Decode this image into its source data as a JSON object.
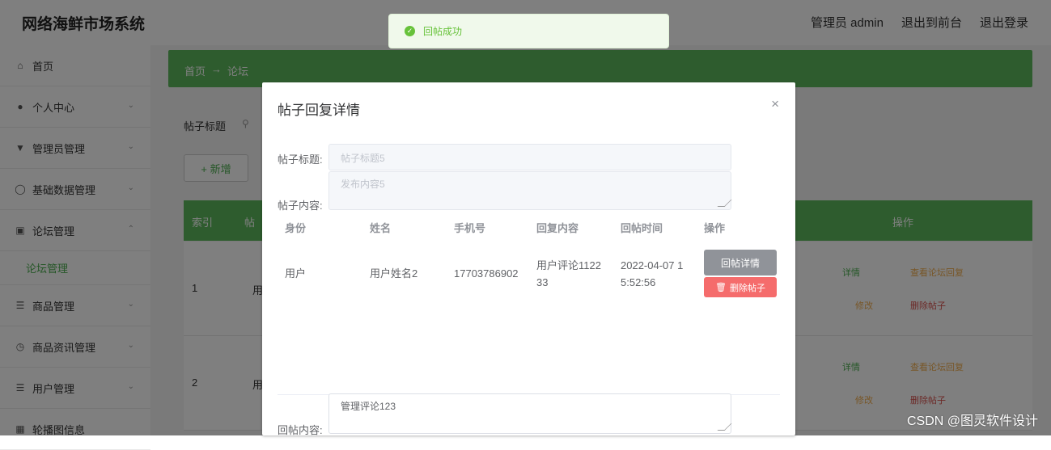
{
  "app": {
    "title": "网络海鲜市场系统"
  },
  "header": {
    "user": "管理员 admin",
    "front": "退出到前台",
    "logout": "退出登录"
  },
  "sidebar": {
    "items": [
      {
        "label": "首页",
        "icon": "home-icon"
      },
      {
        "label": "个人中心",
        "icon": "user-icon"
      },
      {
        "label": "管理员管理",
        "icon": "admin-icon"
      },
      {
        "label": "基础数据管理",
        "icon": "globe-icon"
      },
      {
        "label": "论坛管理",
        "icon": "forum-icon"
      },
      {
        "label": "论坛管理"
      },
      {
        "label": "商品管理",
        "icon": "list-icon"
      },
      {
        "label": "商品资讯管理",
        "icon": "clock-icon"
      },
      {
        "label": "用户管理",
        "icon": "list-icon"
      },
      {
        "label": "轮播图信息",
        "icon": "image-icon"
      }
    ]
  },
  "breadcrumb": {
    "home": "首页",
    "arrow": "→",
    "current": "论坛"
  },
  "search": {
    "label": "帖子标题"
  },
  "toolbar": {
    "add_label": "+ 新增"
  },
  "table": {
    "headers": [
      "索引",
      "帖",
      "操作"
    ],
    "rows": [
      {
        "index": "1",
        "col2": "用",
        "detail": "详情",
        "reply": "查看论坛回复",
        "edit": "修改",
        "delete": "删除帖子"
      },
      {
        "index": "2",
        "col2": "用",
        "detail": "详情",
        "reply": "查看论坛回复",
        "edit": "修改",
        "delete": "删除帖子"
      }
    ]
  },
  "toast": {
    "text": "回帖成功",
    "color": "#67c23a"
  },
  "dialog": {
    "title": "帖子回复详情",
    "close": "×",
    "title_label": "帖子标题:",
    "title_value": "帖子标题5",
    "content_label": "帖子内容:",
    "content_value": "发布内容5",
    "reply_table": {
      "headers": [
        "身份",
        "姓名",
        "手机号",
        "回复内容",
        "回帖时间",
        "操作"
      ],
      "rows": [
        {
          "role": "用户",
          "name": "用户姓名2",
          "phone": "17703786902",
          "content": "用户评论1122 33",
          "time": "2022-04-07 1 5:52:56",
          "detail_btn": "回帖详情",
          "delete_btn": "删除帖子"
        }
      ]
    },
    "reply_label": "回帖内容:",
    "reply_value": "管理评论123"
  },
  "watermark": "CSDN @图灵软件设计"
}
